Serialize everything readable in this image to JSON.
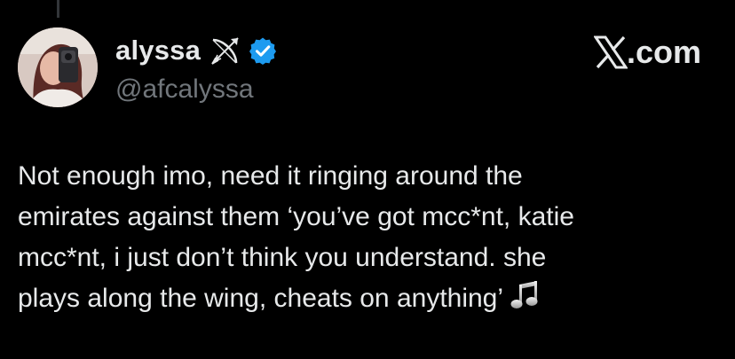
{
  "tweet": {
    "author": {
      "display_name": "alyssa",
      "name_emoji_icon": "bow-and-arrow-icon",
      "verified_icon": "verified-badge-icon",
      "handle": "@afcalyssa",
      "avatar_icon": "profile-photo"
    },
    "brand": {
      "logo_icon": "x-logo-icon",
      "domain": ".com"
    },
    "text_lines": [
      "Not enough imo, need it ringing around the",
      "emirates against them ‘you’ve got mcc*nt, katie",
      "mcc*nt, i just don’t think you understand. she",
      "plays along the wing, cheats on anything’"
    ],
    "trailing_icon": "musical-notes-icon"
  },
  "colors": {
    "background": "#000000",
    "primary_text": "#e7e9ea",
    "secondary_text": "#71767b",
    "verified_blue": "#1d9bf0"
  }
}
